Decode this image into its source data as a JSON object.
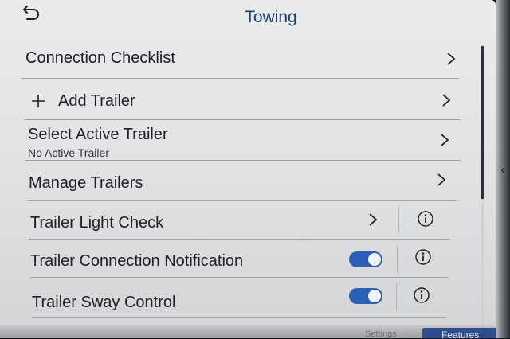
{
  "header": {
    "title": "Towing",
    "back_label": "Back"
  },
  "menu": {
    "connection_checklist": "Connection Checklist",
    "add_trailer": "Add Trailer",
    "select_active_trailer": "Select Active Trailer",
    "select_active_trailer_sub": "No Active Trailer",
    "manage_trailers": "Manage Trailers",
    "trailer_light_check": "Trailer Light Check",
    "trailer_connection_notification": "Trailer Connection Notification",
    "trailer_connection_notification_on": true,
    "trailer_sway_control": "Trailer Sway Control",
    "trailer_sway_control_on": true
  },
  "bottom_bar": {
    "features_label": "Features",
    "partial_label": "Settings"
  },
  "colors": {
    "accent": "#2c5fb7",
    "title": "#1f3f78",
    "background": "#e5e7e9"
  }
}
